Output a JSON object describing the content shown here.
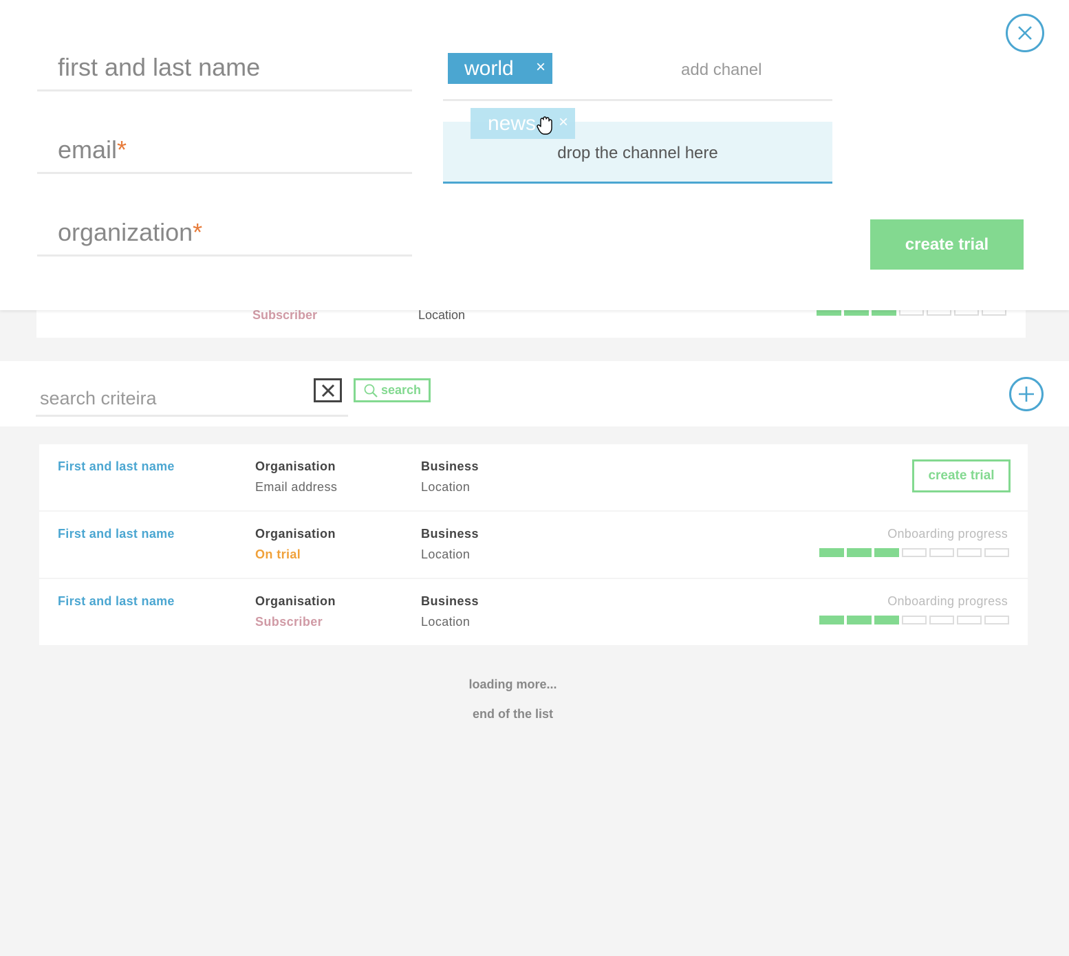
{
  "modal": {
    "fields": {
      "name_placeholder": "first and last name",
      "email_placeholder": "email",
      "organization_placeholder": "organization",
      "required_mark": "*"
    },
    "channels": [
      {
        "label": "world",
        "remove": "×"
      }
    ],
    "add_channel_placeholder": "add chanel",
    "dragged_channel": {
      "label": "news",
      "remove": "×"
    },
    "drop_zone_label": "drop the channel here",
    "create_trial_label": "create trial",
    "close_icon": "close-icon"
  },
  "background_card": {
    "status": "Subscriber",
    "location": "Location",
    "progress": {
      "filled": 3,
      "total": 7
    }
  },
  "search": {
    "placeholder": "search criteira",
    "clear_icon": "x-icon",
    "button_label": "search",
    "add_icon": "plus-icon"
  },
  "rows": [
    {
      "name": "First and last name",
      "organisation": "Organisation",
      "sub": "Email address",
      "business": "Business",
      "location": "Location",
      "action_label": "create trial"
    },
    {
      "name": "First and last name",
      "organisation": "Organisation",
      "sub": "On trial",
      "business": "Business",
      "location": "Location",
      "progress_label": "Onboarding progress",
      "progress": {
        "filled": 3,
        "total": 7
      }
    },
    {
      "name": "First and last name",
      "organisation": "Organisation",
      "sub": "Subscriber",
      "business": "Business",
      "location": "Location",
      "progress_label": "Onboarding progress",
      "progress": {
        "filled": 3,
        "total": 7
      }
    }
  ],
  "footer": {
    "loading": "loading more...",
    "end": "end of the list"
  },
  "colors": {
    "accent_blue": "#4ba6d1",
    "green": "#83d990",
    "trial_orange": "#f0a13a",
    "subscriber_pink": "#d09aa5",
    "required_orange": "#e77b3a"
  }
}
